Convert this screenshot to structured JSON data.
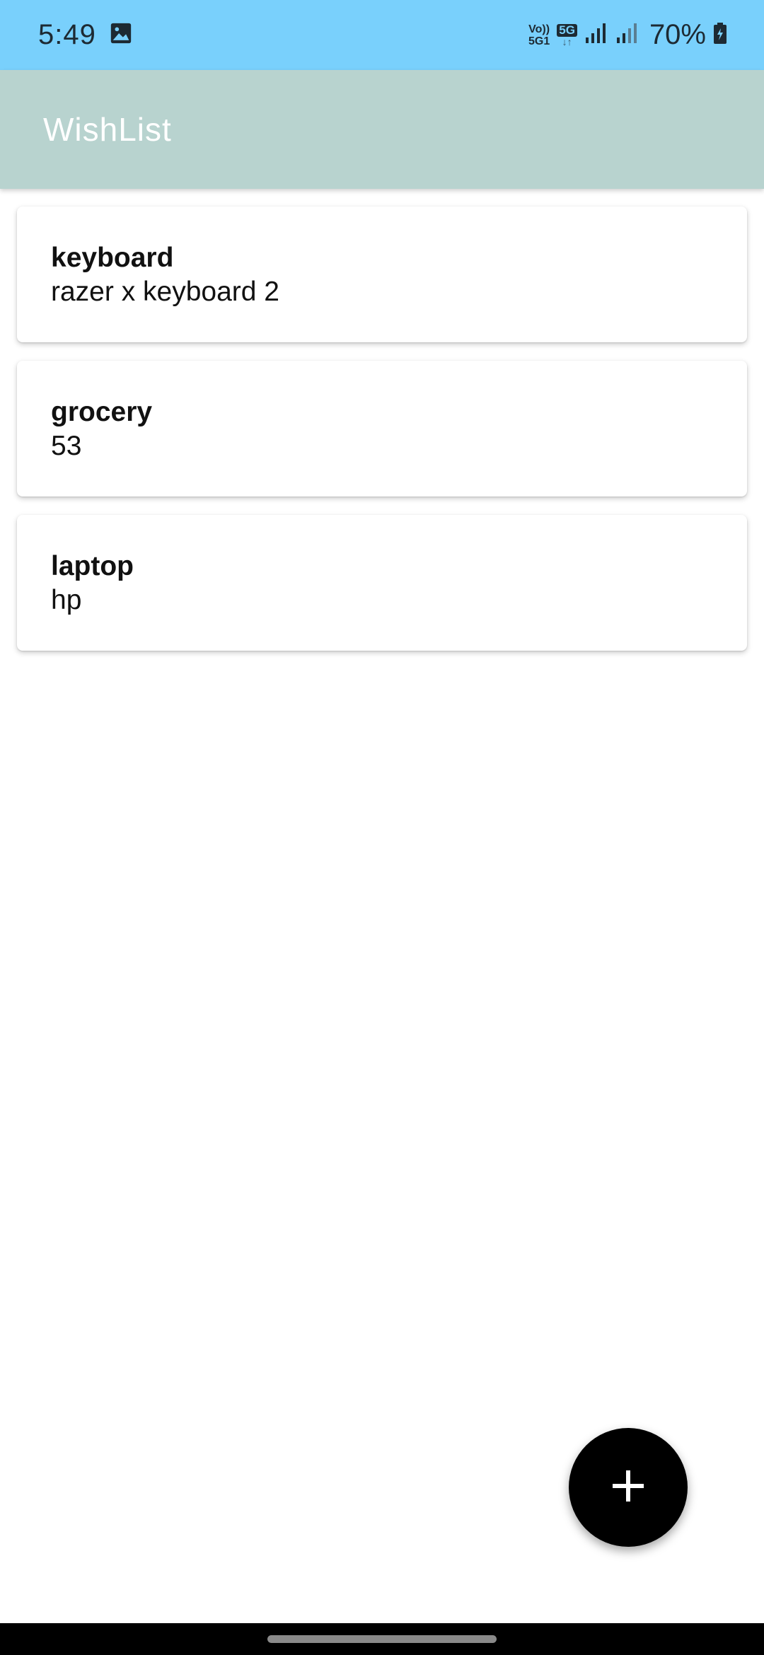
{
  "status_bar": {
    "time": "5:49",
    "network_tag_top": "Vo))",
    "network_tag_bottom": "5G1",
    "fiveg_label": "5G",
    "fiveg_arrows": "↓↑",
    "battery": "70%",
    "icons": [
      "gallery-icon",
      "signal-icon",
      "signal-icon",
      "battery-charging-icon"
    ]
  },
  "app_bar": {
    "title": "WishList",
    "background": "#b8d3cf"
  },
  "items": [
    {
      "title": "keyboard",
      "subtitle": "razer x keyboard 2"
    },
    {
      "title": "grocery",
      "subtitle": "53"
    },
    {
      "title": "laptop",
      "subtitle": "hp"
    }
  ],
  "fab": {
    "icon": "plus-icon",
    "background": "#000000"
  }
}
